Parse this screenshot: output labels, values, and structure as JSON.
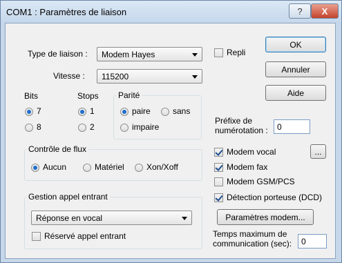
{
  "window": {
    "title": "COM1 : Paramètres de liaison",
    "help_icon": "?",
    "close_icon": "X"
  },
  "connection": {
    "type_label": "Type de liaison :",
    "type_value": "Modem Hayes",
    "speed_label": "Vitesse :",
    "speed_value": "115200",
    "repli_label": "Repli"
  },
  "bits": {
    "title": "Bits",
    "opt1": "7",
    "opt2": "8",
    "selected": "7"
  },
  "stops": {
    "title": "Stops",
    "opt1": "1",
    "opt2": "2",
    "selected": "1"
  },
  "parity": {
    "title": "Parité",
    "opt1": "paire",
    "opt2": "sans",
    "opt3": "impaire",
    "selected": "paire"
  },
  "buttons": {
    "ok": "OK",
    "cancel": "Annuler",
    "help": "Aide",
    "modem_params": "Paramètres modem...",
    "ellipsis": "..."
  },
  "prefix": {
    "label_line1": "Préfixe de",
    "label_line2": "numérotation :",
    "value": "0"
  },
  "flow": {
    "title": "Contrôle de flux",
    "opt1": "Aucun",
    "opt2": "Matériel",
    "opt3": "Xon/Xoff",
    "selected": "Aucun"
  },
  "incoming": {
    "title": "Gestion appel entrant",
    "value": "Réponse en vocal",
    "reserved_label": "Réservé appel entrant"
  },
  "options": {
    "vocal": "Modem vocal",
    "fax": "Modem fax",
    "gsm": "Modem GSM/PCS",
    "dcd": "Détection porteuse (DCD)"
  },
  "timeout": {
    "label_line1": "Temps maximum de",
    "label_line2": "communication (sec):",
    "value": "0"
  }
}
